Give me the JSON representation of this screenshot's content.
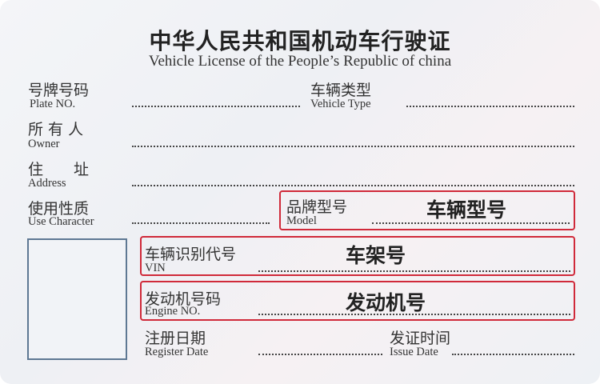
{
  "title": {
    "cn": "中华人民共和国机动车行驶证",
    "en": "Vehicle License of the People’s Republic of china"
  },
  "fields": {
    "plate_no": {
      "cn": "号牌号码",
      "en": "Plate NO."
    },
    "vehicle_type": {
      "cn": "车辆类型",
      "en": "Vehicle Type"
    },
    "owner": {
      "cn": "所 有 人",
      "en": "Owner"
    },
    "address": {
      "cn": "住　　址",
      "en": "Address"
    },
    "use_character": {
      "cn": "使用性质",
      "en": "Use Character"
    },
    "model": {
      "cn": "品牌型号",
      "en": "Model",
      "value": "车辆型号"
    },
    "vin": {
      "cn": "车辆识别代号",
      "en": "VIN",
      "value": "车架号"
    },
    "engine_no": {
      "cn": "发动机号码",
      "en": "Engine NO.",
      "value": "发动机号"
    },
    "register_date": {
      "cn": "注册日期",
      "en": "Register Date"
    },
    "issue_date": {
      "cn": "发证时间",
      "en": "Issue Date"
    }
  },
  "colors": {
    "highlight_border": "#d02a3a",
    "photo_border": "#5e7893"
  }
}
